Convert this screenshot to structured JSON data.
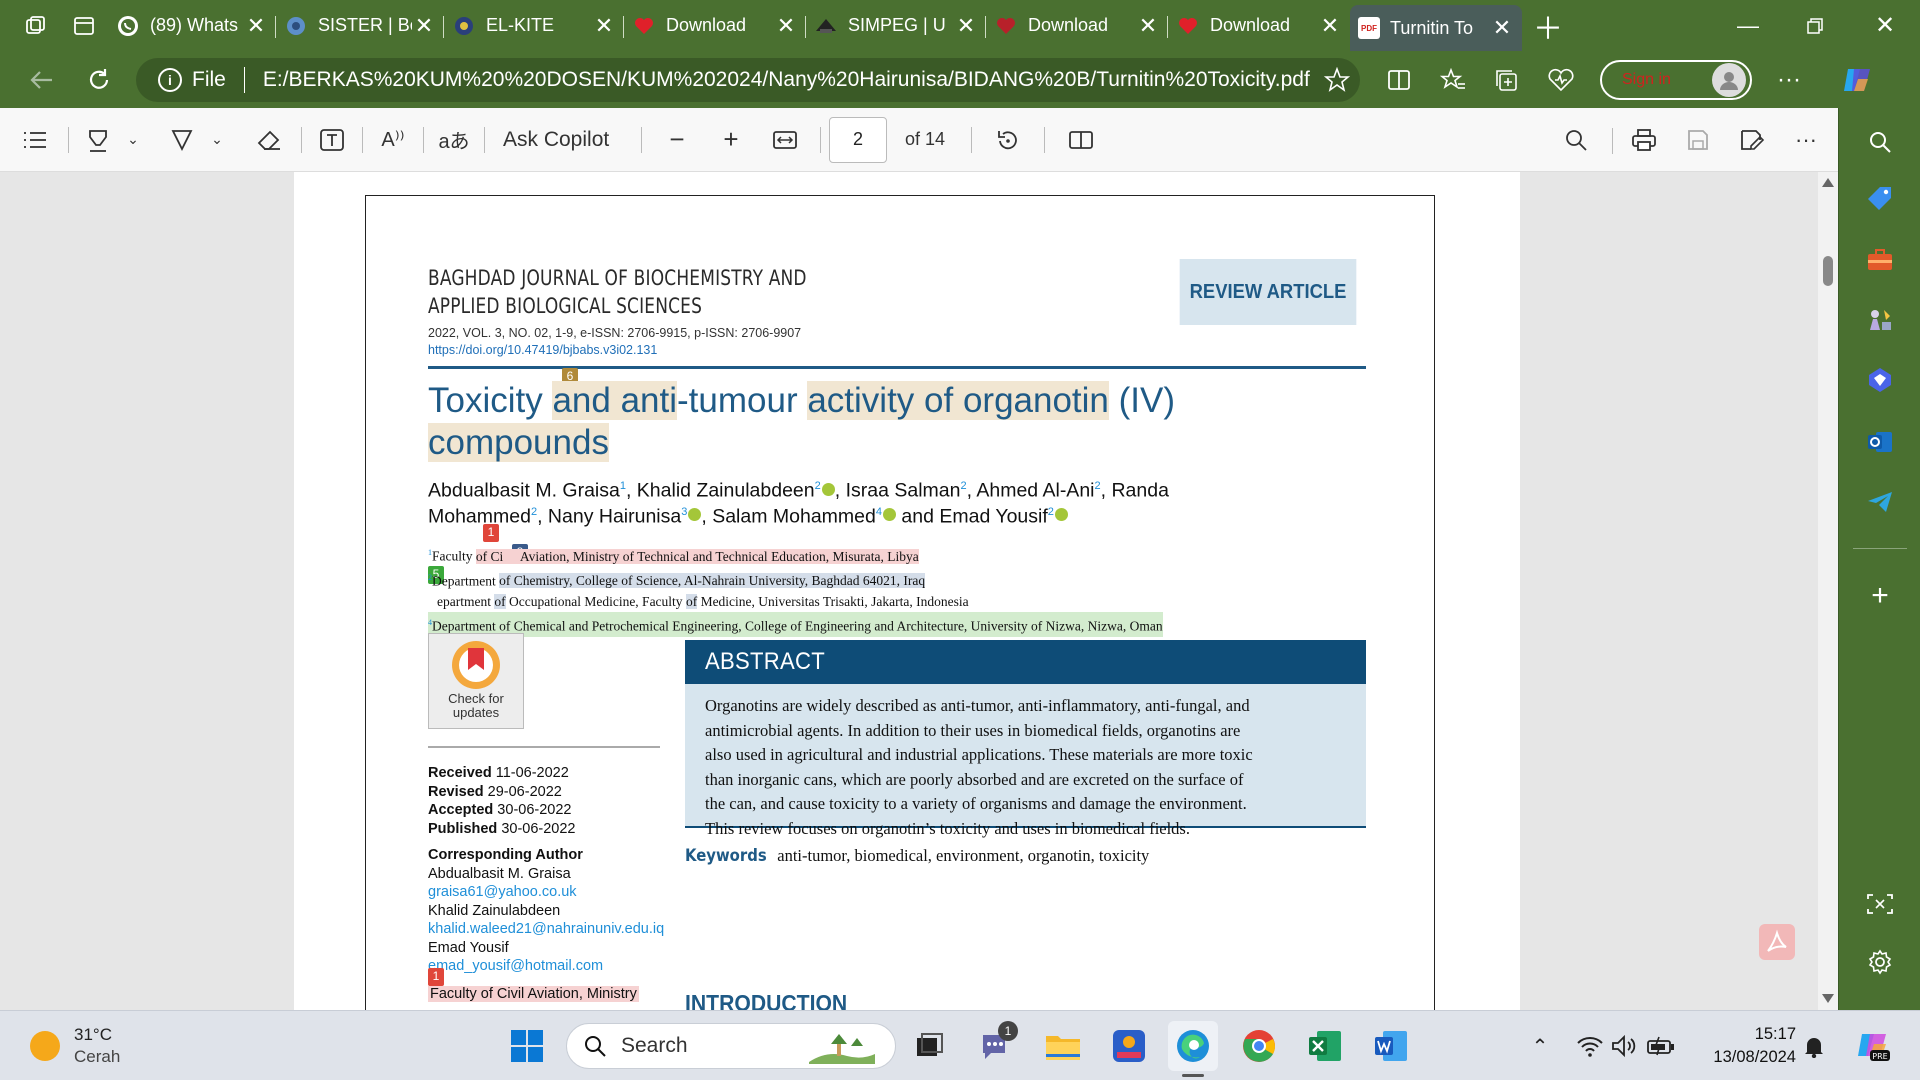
{
  "tabs": [
    {
      "title": "(89) Whats",
      "icon": "whatsapp-icon"
    },
    {
      "title": "SISTER | Be",
      "icon": "sister-icon"
    },
    {
      "title": "EL-KITE",
      "icon": "el-kite-icon"
    },
    {
      "title": "Download",
      "icon": "heart-icon"
    },
    {
      "title": "SIMPEG | U",
      "icon": "simpeg-icon"
    },
    {
      "title": "Download",
      "icon": "heart-icon"
    },
    {
      "title": "Download",
      "icon": "heart-icon"
    },
    {
      "title": "Turnitin To",
      "icon": "pdf-icon",
      "fav_label": "PDF"
    }
  ],
  "address": {
    "file_label": "File",
    "url": "E:/BERKAS%20KUM%20%20DOSEN/KUM%202024/Nany%20Hairunisa/BIDANG%20B/Turnitin%20Toxicity.pdf",
    "signin": "Sign in"
  },
  "pdfbar": {
    "ask_copilot": "Ask Copilot",
    "page": "2",
    "of_total": "of 14"
  },
  "paper": {
    "journal_line1": "BAGHDAD JOURNAL OF BIOCHEMISTRY AND",
    "journal_line2": "APPLIED BIOLOGICAL SCIENCES",
    "issue": "2022, VOL. 3, NO. 02, 1-9, e-ISSN: 2706-9915, p-ISSN: 2706-9907",
    "doi": "https://doi.org/10.47419/bjbabs.v3i02.131",
    "badge": "REVIEW ARTICLE",
    "title_a": "Toxicity ",
    "title_b": "and anti",
    "title_c": "-tumour ",
    "title_d": "activity of organotin",
    "title_e": " (IV)",
    "title_f": "compounds",
    "marks": {
      "m6": "6",
      "m1": "1",
      "m8": "8",
      "m5": "5",
      "m1b": "1"
    },
    "authors_line1": {
      "a1": "Abdualbasit M. Graisa",
      "s1": "1",
      "a2": ", Khalid Zainulabdeen",
      "s2": "2",
      "a3": ", Israa Salman",
      "s3": "2",
      "a4": ", Ahmed Al-Ani",
      "s4": "2",
      "a5": ", Randa"
    },
    "authors_line2": {
      "a1": "Mohammed",
      "s1": "2",
      "a2": ", Nany Hairunisa",
      "s2": "3",
      "a3": ", Salam Mohammed",
      "s3": "4",
      "a4": " and Emad Yousif",
      "s4": "2"
    },
    "affiliations": {
      "s1": "1",
      "a1_pre": "Faculty ",
      "a1_of": "of Ci",
      "a1_rest": " Aviation, Ministry of Technical and Technical Education, Misurata, Libya",
      "s2": "2",
      "a2_pre": "Department ",
      "a2_rest": "of Chemistry, College of Science, Al-Nahrain University, Baghdad 64021, Iraq",
      "a3_a": "epartment ",
      "a3_of": "of",
      "a3_b": " Occupational Medicine, Faculty ",
      "a3_of2": "of",
      "a3_c": " Medicine, Universitas Trisakti, Jakarta, Indonesia",
      "s4": "4",
      "a4": "Department of Chemical and Petrochemical Engineering, College of Engineering and Architecture, University of Nizwa, Nizwa, Oman"
    },
    "check_updates_1": "Check for",
    "check_updates_2": "updates",
    "dates": [
      {
        "label": "Received",
        "value": " 11-06-2022"
      },
      {
        "label": "Revised",
        "value": " 29-06-2022"
      },
      {
        "label": "Accepted",
        "value": " 30-06-2022"
      },
      {
        "label": "Published",
        "value": " 30-06-2022"
      }
    ],
    "corresponding_label": "Corresponding Author",
    "corr": [
      {
        "name": "Abdualbasit M. Graisa",
        "email": "graisa61@yahoo.co.uk"
      },
      {
        "name": "Khalid Zainulabdeen",
        "email": "khalid.waleed21@nahrainuniv.edu.iq"
      },
      {
        "name": "Emad Yousif",
        "email": "emad_yousif@hotmail.com"
      }
    ],
    "footer_hl": "Faculty of Civil Aviation, Ministry",
    "abstract_title": "ABSTRACT",
    "abstract_lines": [
      "Organotins are widely described as anti-tumor, anti-inflammatory, anti-fungal, and",
      "antimicrobial agents.  In addition to their uses in biomedical fields, organotins are",
      "also used in agricultural and industrial applications.  These materials are more toxic",
      "than inorganic cans, which are poorly absorbed and are excreted on the surface of",
      "the can, and cause toxicity to a variety of organisms and damage the environment.",
      "This review focuses on organotin’s toxicity and uses in biomedical fields."
    ],
    "keywords_label": "Keywords",
    "keywords": "anti-tumor, biomedical, environment, organotin, toxicity",
    "intro": "INTRODUCTION"
  },
  "taskbar": {
    "temp": "31°C",
    "weather": "Cerah",
    "search": "Search",
    "time": "15:17",
    "date": "13/08/2024",
    "teams_badge": "1"
  },
  "colors": {
    "journal_blue": "#1f5a86",
    "navy": "#0e4c77"
  }
}
